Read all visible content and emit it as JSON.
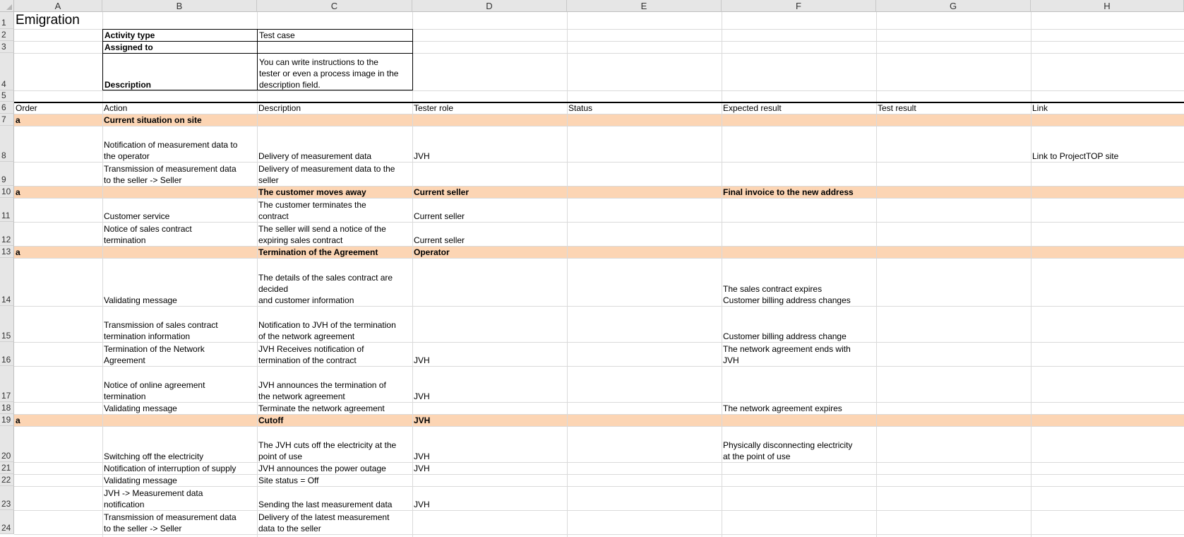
{
  "sheet": {
    "columns": [
      "A",
      "B",
      "C",
      "D",
      "E",
      "F",
      "G",
      "H"
    ],
    "rows": [
      "1",
      "2",
      "3",
      "4",
      "5",
      "6",
      "7",
      "8",
      "9",
      "10",
      "11",
      "12",
      "13",
      "14",
      "15",
      "16",
      "17",
      "18",
      "19",
      "20",
      "21",
      "22",
      "23",
      "24"
    ],
    "title": "Emigration",
    "info": {
      "activity_type_label": "Activity type",
      "activity_type_value": "Test case",
      "assigned_to_label": "Assigned to",
      "assigned_to_value": "",
      "description_label": "Description",
      "description_value": [
        "You can write instructions to the",
        "tester or even a process image in the",
        "description field."
      ]
    },
    "headers": [
      "Order",
      "Action",
      "Description",
      "Tester role",
      "Status",
      "Expected result",
      "Test result",
      "Link"
    ],
    "band_color": "#fcd5b4",
    "body": [
      {
        "row": 7,
        "band": true,
        "cells": {
          "A": [
            "a"
          ],
          "B": [
            "Current situation on site"
          ]
        }
      },
      {
        "row": 8,
        "band": false,
        "cells": {
          "B": [
            "Notification of measurement data to",
            "the operator"
          ],
          "C": [
            "Delivery of measurement data"
          ],
          "D": [
            "JVH"
          ],
          "H": [
            "Link to ProjectTOP site"
          ]
        }
      },
      {
        "row": 9,
        "band": false,
        "cells": {
          "B": [
            "Transmission of measurement data",
            "to the seller -> Seller"
          ],
          "C": [
            "Delivery of measurement data to the",
            "seller"
          ]
        }
      },
      {
        "row": 10,
        "band": true,
        "cells": {
          "A": [
            "a"
          ],
          "C": [
            "The customer moves away"
          ],
          "D": [
            "Current seller"
          ],
          "F": [
            "Final invoice to the new address"
          ]
        }
      },
      {
        "row": 11,
        "band": false,
        "cells": {
          "B": [
            "Customer service"
          ],
          "C": [
            "The customer terminates the",
            "contract"
          ],
          "D": [
            "Current seller"
          ]
        }
      },
      {
        "row": 12,
        "band": false,
        "cells": {
          "B": [
            "Notice of sales contract",
            "termination"
          ],
          "C": [
            "The seller will send a notice of the",
            "expiring sales contract"
          ],
          "D": [
            "Current seller"
          ]
        }
      },
      {
        "row": 13,
        "band": true,
        "cells": {
          "A": [
            "a"
          ],
          "C": [
            "Termination of the Agreement"
          ],
          "D": [
            "Operator"
          ]
        }
      },
      {
        "row": 14,
        "band": false,
        "cells": {
          "B": [
            "Validating message"
          ],
          "C": [
            "The details of the sales contract are",
            "decided",
            "and customer information"
          ],
          "F": [
            "The sales contract expires",
            "Customer billing address changes"
          ]
        }
      },
      {
        "row": 15,
        "band": false,
        "cells": {
          "B": [
            "Transmission of sales contract",
            "termination information"
          ],
          "C": [
            "Notification to JVH of the termination",
            "of the network agreement"
          ],
          "F": [
            "Customer billing address change"
          ]
        }
      },
      {
        "row": 16,
        "band": false,
        "cells": {
          "B": [
            "Termination of the Network",
            "Agreement"
          ],
          "C": [
            "JVH Receives notification of",
            "termination of the contract"
          ],
          "D": [
            "JVH"
          ],
          "F": [
            "The network agreement ends with",
            "JVH"
          ]
        }
      },
      {
        "row": 17,
        "band": false,
        "cells": {
          "B": [
            "Notice of online agreement",
            "termination"
          ],
          "C": [
            "JVH announces the termination of",
            "the network agreement"
          ],
          "D": [
            "JVH"
          ]
        }
      },
      {
        "row": 18,
        "band": false,
        "cells": {
          "B": [
            "Validating message"
          ],
          "C": [
            "Terminate the network agreement"
          ],
          "F": [
            "The network agreement expires"
          ]
        }
      },
      {
        "row": 19,
        "band": true,
        "cells": {
          "A": [
            "a"
          ],
          "C": [
            " Cutoff"
          ],
          "D": [
            "JVH"
          ]
        }
      },
      {
        "row": 20,
        "band": false,
        "cells": {
          "B": [
            "Switching off the electricity"
          ],
          "C": [
            "The JVH cuts off the electricity at the",
            "point of use"
          ],
          "D": [
            "JVH"
          ],
          "F": [
            "Physically disconnecting electricity",
            "at the point of use"
          ]
        }
      },
      {
        "row": 21,
        "band": false,
        "cells": {
          "B": [
            "Notification of interruption of supply"
          ],
          "C": [
            "JVH announces the power outage"
          ],
          "D": [
            "JVH"
          ]
        }
      },
      {
        "row": 22,
        "band": false,
        "cells": {
          "B": [
            "Validating message"
          ],
          "C": [
            "Site status = Off"
          ]
        }
      },
      {
        "row": 23,
        "band": false,
        "cells": {
          "B": [
            "JVH -> Measurement data",
            "notification"
          ],
          "C": [
            "Sending the last measurement data"
          ],
          "D": [
            "JVH"
          ]
        }
      },
      {
        "row": 24,
        "band": false,
        "cells": {
          "B": [
            "Transmission of measurement data",
            "to the seller -> Seller"
          ],
          "C": [
            "Delivery of the latest measurement",
            "data to the seller"
          ]
        }
      }
    ]
  }
}
